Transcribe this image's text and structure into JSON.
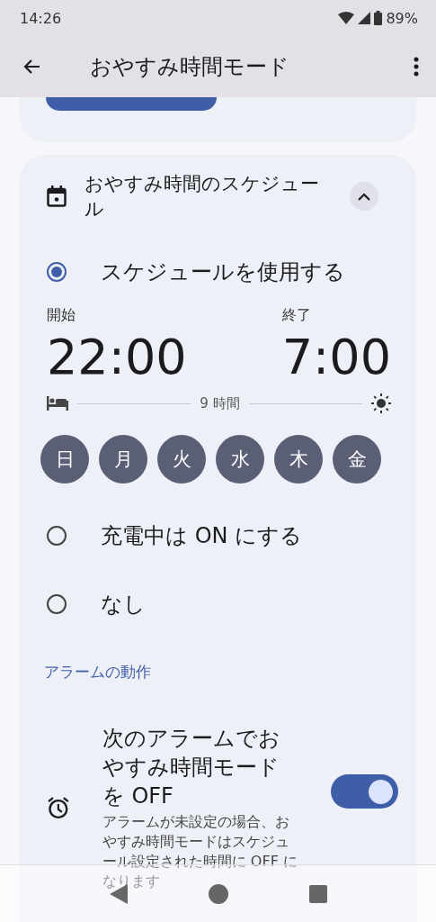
{
  "status_bar": {
    "time": "14:26",
    "battery": "89%"
  },
  "app_bar": {
    "title": "おやすみ時間モード"
  },
  "schedule": {
    "title": "おやすみ時間のスケジュール",
    "expanded": true,
    "options": [
      {
        "kind": "schedule",
        "label": "スケジュールを使用する",
        "selected": true,
        "start_label": "開始",
        "start": "22:00",
        "end_label": "終了",
        "end": "7:00",
        "duration": "9 時間",
        "days": [
          {
            "label": "日",
            "selected": true
          },
          {
            "label": "月",
            "selected": true
          },
          {
            "label": "火",
            "selected": true
          },
          {
            "label": "水",
            "selected": true
          },
          {
            "label": "木",
            "selected": true
          },
          {
            "label": "金",
            "selected": true
          }
        ]
      },
      {
        "kind": "plain",
        "label": "充電中は ON にする",
        "selected": false
      },
      {
        "kind": "plain",
        "label": "なし",
        "selected": false
      }
    ],
    "section": "アラームの動作",
    "alarm": {
      "title": "次のアラームでおやすみ時間モードを OFF",
      "description": "アラームが未設定の場合、おやすみ時間モードはスケジュール設定された時間に OFF になります",
      "on": true
    }
  }
}
